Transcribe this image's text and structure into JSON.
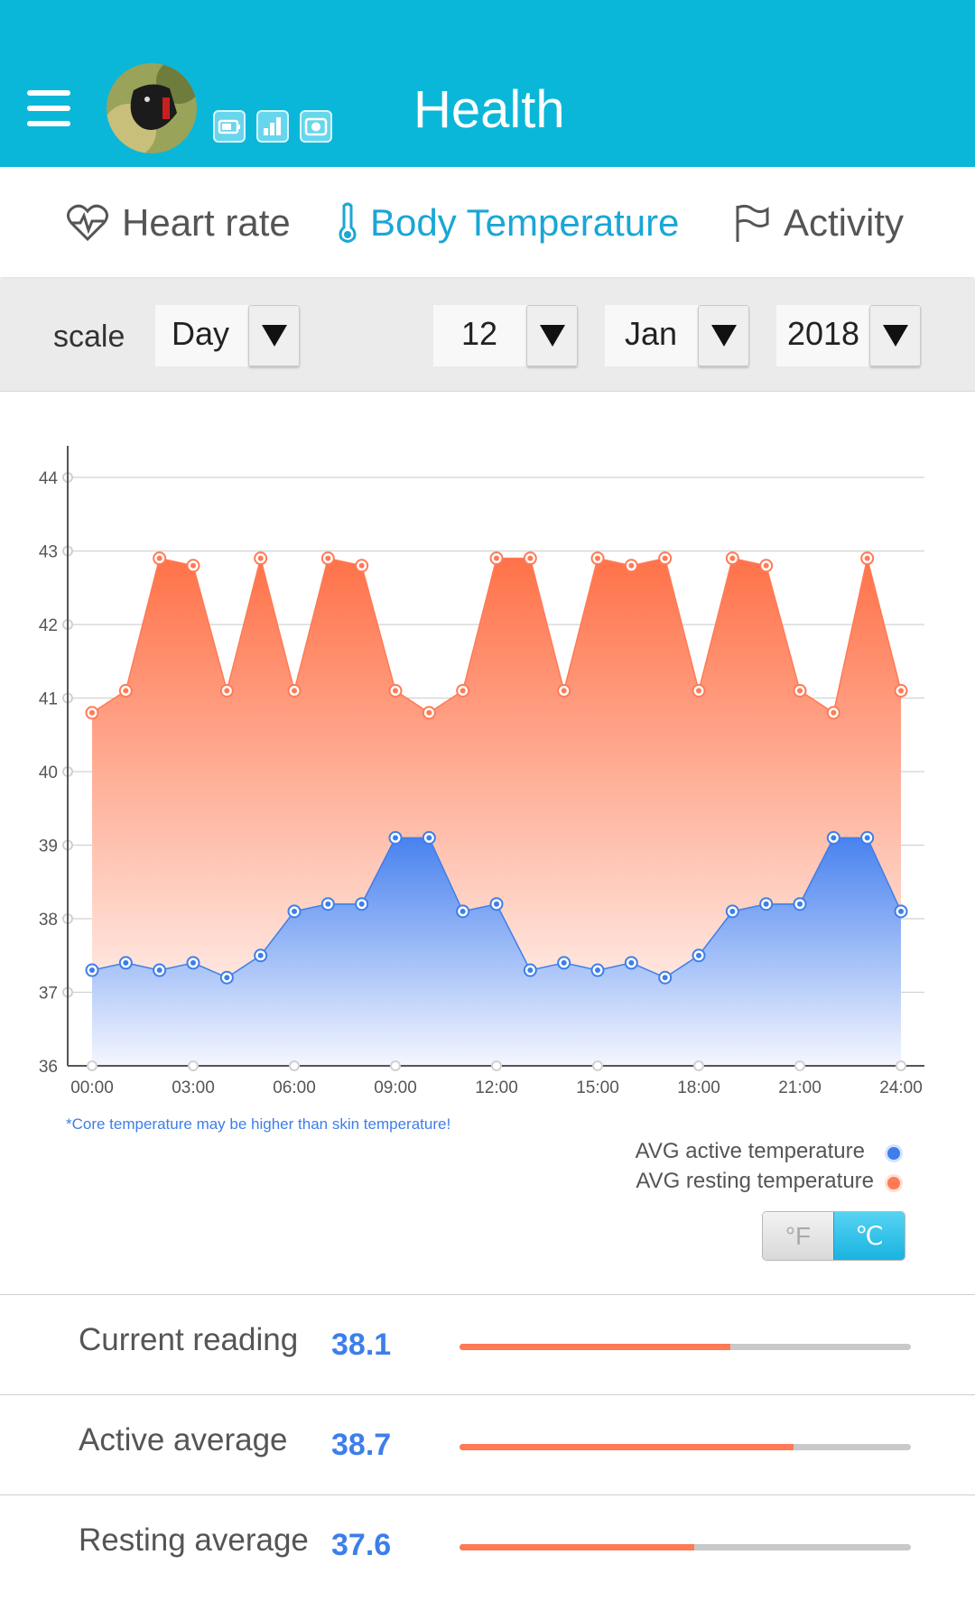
{
  "header": {
    "title": "Health",
    "menu_icon": "hamburger-icon",
    "device_icons": [
      "battery-icon",
      "signal-icon",
      "camera-icon"
    ]
  },
  "tabs": [
    {
      "label": "Heart rate",
      "icon": "heart-pulse-icon",
      "active": false
    },
    {
      "label": "Body Temperature",
      "icon": "thermometer-icon",
      "active": true
    },
    {
      "label": "Activity",
      "icon": "flag-icon",
      "active": false
    }
  ],
  "filters": {
    "scale_label": "scale",
    "scale": "Day",
    "day": "12",
    "month": "Jan",
    "year": "2018"
  },
  "chart_data": {
    "type": "area",
    "x": [
      "00:00",
      "01:00",
      "02:00",
      "03:00",
      "04:00",
      "05:00",
      "06:00",
      "07:00",
      "08:00",
      "09:00",
      "10:00",
      "11:00",
      "12:00",
      "13:00",
      "14:00",
      "15:00",
      "16:00",
      "17:00",
      "18:00",
      "19:00",
      "20:00",
      "21:00",
      "22:00",
      "23:00",
      "24:00"
    ],
    "x_tick_labels": [
      "00:00",
      "03:00",
      "06:00",
      "09:00",
      "12:00",
      "15:00",
      "18:00",
      "21:00",
      "24:00"
    ],
    "y_tick_labels": [
      "36",
      "37",
      "38",
      "39",
      "40",
      "41",
      "42",
      "43",
      "44"
    ],
    "ylim": [
      36,
      44
    ],
    "series": [
      {
        "name": "AVG resting temperature",
        "color": "#ff7a55",
        "values": [
          40.8,
          41.1,
          42.9,
          42.8,
          41.1,
          42.9,
          41.1,
          42.9,
          42.8,
          41.1,
          40.8,
          41.1,
          42.9,
          42.9,
          41.1,
          42.9,
          42.8,
          42.9,
          41.1,
          42.9,
          42.8,
          41.1,
          40.8,
          42.9,
          41.1
        ]
      },
      {
        "name": "AVG active temperature",
        "color": "#3d7eea",
        "values": [
          37.3,
          37.4,
          37.3,
          37.4,
          37.2,
          37.5,
          38.1,
          38.2,
          38.2,
          39.1,
          39.1,
          38.1,
          38.2,
          37.3,
          37.4,
          37.3,
          37.4,
          37.2,
          37.5,
          38.1,
          38.2,
          38.2,
          39.1,
          39.1,
          38.1
        ]
      }
    ],
    "grid": true,
    "legend_position": "bottom-right",
    "note": "*Core temperature may be higher than skin temperature!"
  },
  "units": {
    "fahrenheit": "°F",
    "celsius": "℃",
    "selected": "celsius"
  },
  "stats": [
    {
      "label": "Current reading",
      "value": "38.1",
      "fill": 0.6
    },
    {
      "label": "Active average",
      "value": "38.7",
      "fill": 0.74
    },
    {
      "label": "Resting average",
      "value": "37.6",
      "fill": 0.52
    }
  ]
}
